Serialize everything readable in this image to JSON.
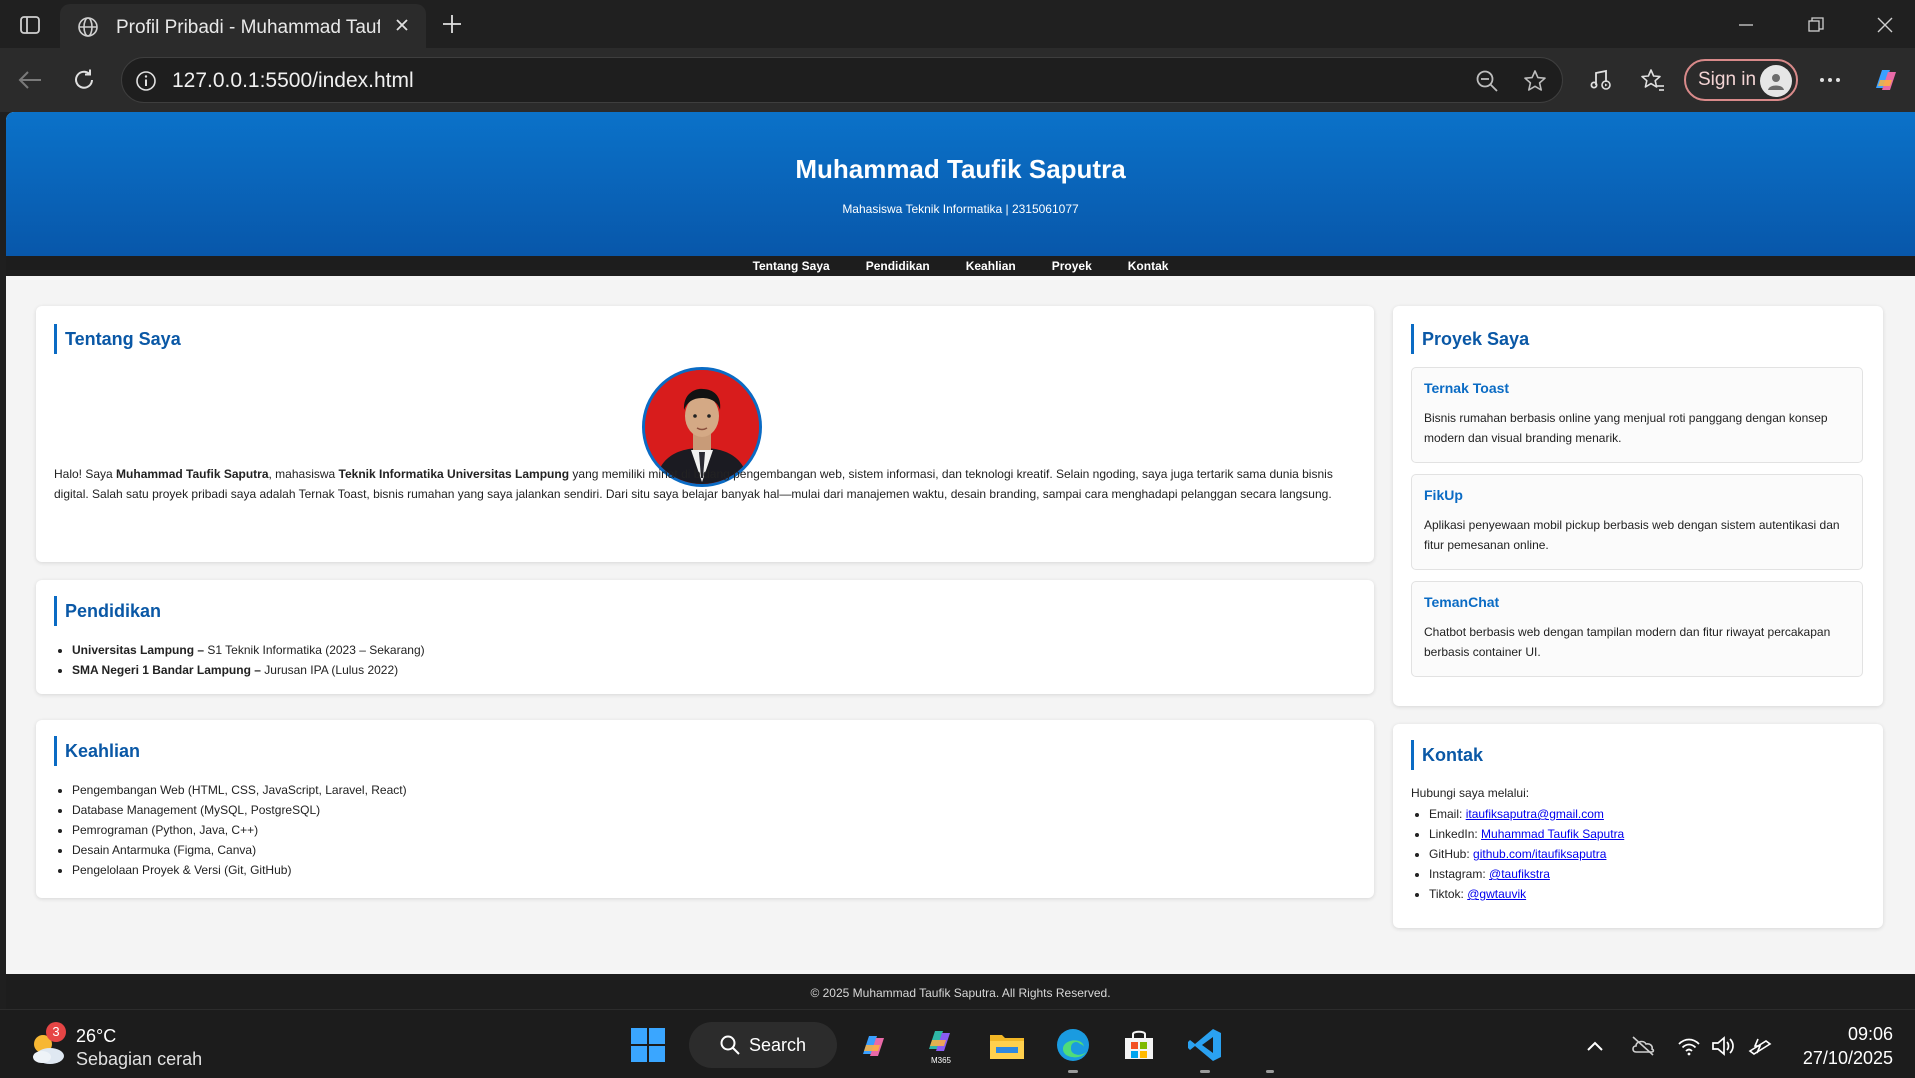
{
  "browser": {
    "tab_title": "Profil Pribadi - Muhammad Taufik Saputra",
    "url": "127.0.0.1:5500/index.html",
    "sign_in_label": "Sign in"
  },
  "site": {
    "name": "Muhammad Taufik Saputra",
    "subtitle": "Mahasiswa Teknik Informatika | 2315061077",
    "nav": [
      "Tentang Saya",
      "Pendidikan",
      "Keahlian",
      "Proyek",
      "Kontak"
    ],
    "about": {
      "heading": "Tentang Saya",
      "intro": "Halo! Saya ",
      "name_bold": "Muhammad Taufik Saputra",
      "mid": ", mahasiswa ",
      "study_bold": "Teknik Informatika Universitas Lampung",
      "rest": " yang memiliki minat di bidang pengembangan web, sistem informasi, dan teknologi kreatif. Selain ngoding, saya juga tertarik sama dunia bisnis digital. Salah satu proyek pribadi saya adalah Ternak Toast, bisnis rumahan yang saya jalankan sendiri. Dari situ saya belajar banyak hal—mulai dari manajemen waktu, desain branding, sampai cara menghadapi pelanggan secara langsung."
    },
    "education": {
      "heading": "Pendidikan",
      "items": [
        {
          "school": "Universitas Lampung –",
          "detail": " S1 Teknik Informatika (2023 – Sekarang)"
        },
        {
          "school": "SMA Negeri 1 Bandar Lampung –",
          "detail": " Jurusan IPA (Lulus 2022)"
        }
      ]
    },
    "skills": {
      "heading": "Keahlian",
      "items": [
        "Pengembangan Web (HTML, CSS, JavaScript, Laravel, React)",
        "Database Management (MySQL, PostgreSQL)",
        "Pemrograman (Python, Java, C++)",
        "Desain Antarmuka (Figma, Canva)",
        "Pengelolaan Proyek & Versi (Git, GitHub)"
      ]
    },
    "projects": {
      "heading": "Proyek Saya",
      "items": [
        {
          "title": "Ternak Toast",
          "desc": "Bisnis rumahan berbasis online yang menjual roti panggang dengan konsep modern dan visual branding menarik."
        },
        {
          "title": "FikUp",
          "desc": "Aplikasi penyewaan mobil pickup berbasis web dengan sistem autentikasi dan fitur pemesanan online."
        },
        {
          "title": "TemanChat",
          "desc": "Chatbot berbasis web dengan tampilan modern dan fitur riwayat percakapan berbasis container UI."
        }
      ]
    },
    "contact": {
      "heading": "Kontak",
      "intro": "Hubungi saya melalui:",
      "items": [
        {
          "label": "Email: ",
          "link": "itaufiksaputra@gmail.com"
        },
        {
          "label": "LinkedIn: ",
          "link": "Muhammad Taufik Saputra"
        },
        {
          "label": "GitHub: ",
          "link": "github.com/itaufiksaputra"
        },
        {
          "label": "Instagram: ",
          "link": "@taufikstra"
        },
        {
          "label": "Tiktok: ",
          "link": "@gwtauvik"
        }
      ]
    },
    "footer": "© 2025 Muhammad Taufik Saputra. All Rights Reserved."
  },
  "taskbar": {
    "weather_temp": "26°C",
    "weather_desc": "Sebagian cerah",
    "weather_badge": "3",
    "search_label": "Search",
    "time": "09:06",
    "date": "27/10/2025"
  }
}
